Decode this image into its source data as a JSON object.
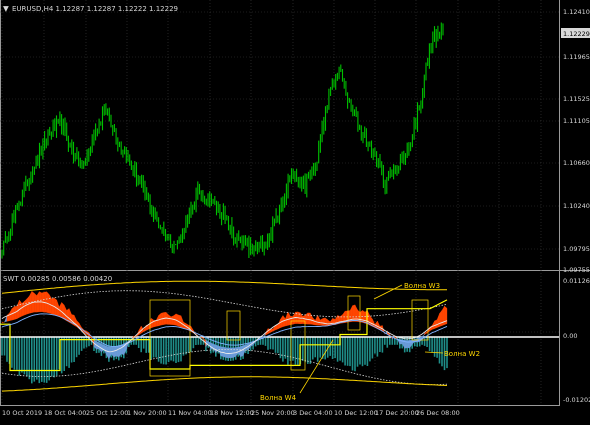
{
  "colors": {
    "background": "#000000",
    "text": "#d8d8d8",
    "grid": "#3a3a3a",
    "price": "#00c000",
    "price_tag_bg": "#d8d8d8",
    "price_tag_text": "#000000",
    "fill_red": "#ff4500",
    "fill_blue": "#6a9bd8",
    "hist_teal": "#1f8f8a",
    "yellow": "#ffd700",
    "yellow_bright": "#ffff00",
    "band": "#d8d8d8",
    "overlay_white": "#e8e8e8",
    "overlay_blue": "#7fb2ff"
  },
  "main_pane": {
    "title": "EURUSD,H4  1.12287 1.12287 1.12222 1.12229",
    "menu_icon": "triangle-down-icon",
    "price_tag": "1.12229",
    "y_ticks": [
      "1.12410",
      "1.11965",
      "1.11525",
      "1.11105",
      "1.10660",
      "1.10240",
      "1.09795",
      "1.09755"
    ]
  },
  "sub_pane": {
    "title": "SWT 0.00285 0.00586 0.00420",
    "y_ticks": [
      "0.01126",
      "0.00",
      "-0.01202"
    ],
    "labels": [
      "Волна W3",
      "Волна W2",
      "Волна W4"
    ]
  },
  "x_axis": {
    "labels": [
      "10 Oct 2019",
      "18 Oct 04:00",
      "25 Oct 12:00",
      "1 Nov 20:00",
      "11 Nov 04:00",
      "18 Nov 12:00",
      "25 Nov 20:00",
      "3 Dec 04:00",
      "10 Dec 12:00",
      "17 Dec 20:00",
      "26 Dec 08:00"
    ]
  },
  "chart_data": [
    {
      "type": "line",
      "title": "EURUSD,H4  1.12287 1.12287 1.12222 1.12229",
      "xlabel": "",
      "ylabel": "",
      "x": [
        "10 Oct 2019",
        "18 Oct 04:00",
        "25 Oct 12:00",
        "1 Nov 20:00",
        "11 Nov 04:00",
        "18 Nov 12:00",
        "25 Nov 20:00",
        "3 Dec 04:00",
        "10 Dec 12:00",
        "17 Dec 20:00",
        "26 Dec 08:00"
      ],
      "ylim": [
        1.097,
        1.125
      ],
      "series": [
        {
          "values": [
            1.099,
            1.1025,
            1.106,
            1.109,
            1.1115,
            1.113,
            1.11,
            1.108,
            1.112,
            1.1145,
            1.111,
            1.1085,
            1.106,
            1.103,
            1.101,
            1.0995,
            1.1025,
            1.1055,
            1.1045,
            1.103,
            1.1005,
            1.0995,
            1.099,
            1.1005,
            1.104,
            1.1075,
            1.106,
            1.108,
            1.115,
            1.119,
            1.1145,
            1.112,
            1.1095,
            1.1065,
            1.108,
            1.11,
            1.115,
            1.122,
            1.1229
          ]
        }
      ]
    },
    {
      "type": "area",
      "title": "SWT 0.00285 0.00586 0.00420",
      "ylim": [
        -0.01202,
        0.01126
      ],
      "series": [
        {
          "name": "",
          "values": [
            0.003,
            0.006,
            0.008,
            0.009,
            0.007,
            0.005,
            0.002,
            -0.002,
            -0.004,
            -0.003,
            0.001,
            0.003,
            0.005,
            0.004,
            0.002,
            -0.001,
            -0.003,
            -0.004,
            -0.003,
            -0.001,
            0.002,
            0.004,
            0.005,
            0.004,
            0.003,
            0.004,
            0.006,
            0.005,
            0.002,
            0.0,
            -0.002,
            -0.001,
            0.003,
            0.006
          ]
        }
      ]
    }
  ]
}
